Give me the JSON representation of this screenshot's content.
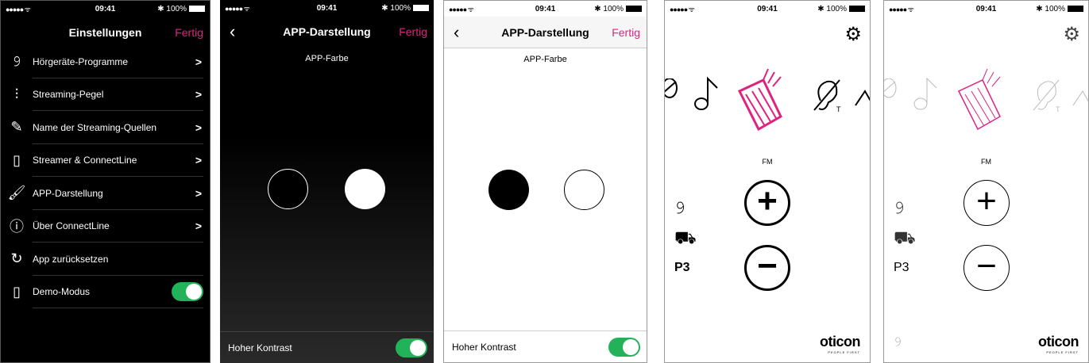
{
  "status": {
    "signal": "●●●●● ᯤ",
    "time": "09:41",
    "battery": "✱ 100%"
  },
  "screen1": {
    "title": "Einstellungen",
    "done": "Fertig",
    "items": [
      {
        "label": "Hörgeräte-Programme",
        "icon": "ear-icon"
      },
      {
        "label": "Streaming-Pegel",
        "icon": "sliders-icon"
      },
      {
        "label": "Name der Streaming-Quellen",
        "icon": "pencil-icon"
      },
      {
        "label": "Streamer & ConnectLine",
        "icon": "streamer-icon"
      },
      {
        "label": "APP-Darstellung",
        "icon": "brush-icon"
      },
      {
        "label": "Über ConnectLine",
        "icon": "info-icon"
      },
      {
        "label": "App zurücksetzen",
        "icon": "reset-icon"
      },
      {
        "label": "Demo-Modus",
        "icon": "phone-icon"
      }
    ]
  },
  "screen2": {
    "title": "APP-Darstellung",
    "done": "Fertig",
    "app_color": "APP-Farbe",
    "contrast": "Hoher Kontrast"
  },
  "screen3": {
    "title": "APP-Darstellung",
    "done": "Fertig",
    "app_color": "APP-Farbe",
    "contrast": "Hoher Kontrast"
  },
  "screen4": {
    "source": "FM",
    "program": "P3",
    "logo": "oticon",
    "tagline": "PEOPLE FIRST"
  },
  "screen5": {
    "source": "FM",
    "program": "P3",
    "logo": "oticon",
    "tagline": "PEOPLE FIRST"
  },
  "colors": {
    "accent": "#e0227f",
    "toggle": "#22b35a"
  }
}
